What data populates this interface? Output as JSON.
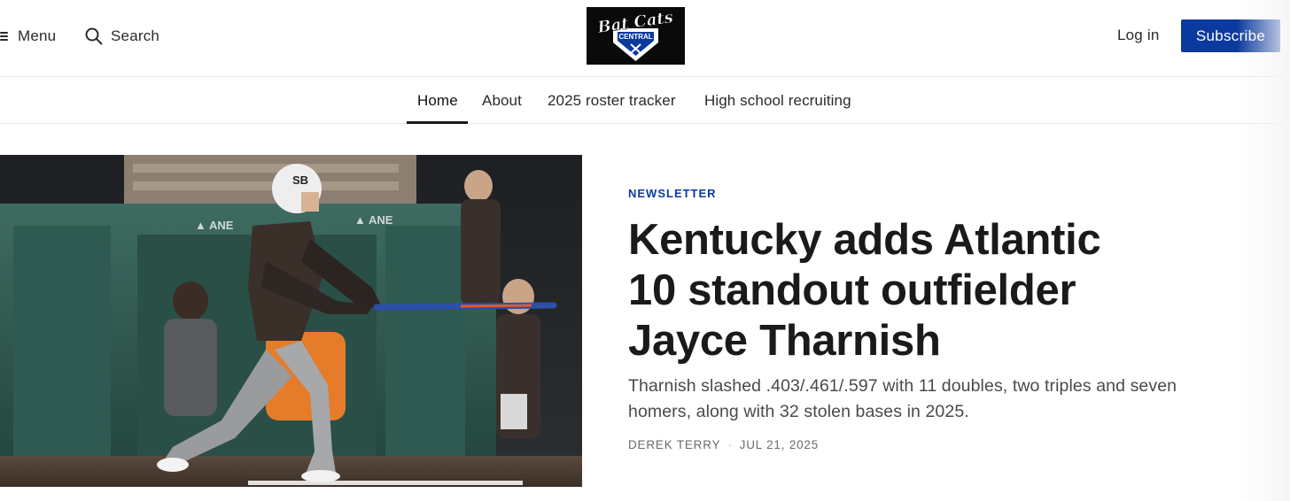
{
  "header": {
    "menu_label": "Menu",
    "search_label": "Search",
    "logo_text_top": "Bat Cats",
    "logo_text_bottom": "CENTRAL",
    "login_label": "Log in",
    "subscribe_label": "Subscribe",
    "accent_color": "#0b3a9e"
  },
  "nav": {
    "items": [
      {
        "label": "Home",
        "active": true
      },
      {
        "label": "About",
        "active": false
      },
      {
        "label": "2025 roster tracker",
        "active": false
      },
      {
        "label": "High school recruiting",
        "active": false
      }
    ]
  },
  "article": {
    "category": "NEWSLETTER",
    "headline": "Kentucky adds Atlantic 10 standout outfielder Jayce Tharnish",
    "subtitle": "Tharnish slashed .403/.461/.597 with 11 doubles, two triples and seven homers, along with 32 stolen bases in 2025.",
    "author": "DEREK TERRY",
    "date": "JUL 21, 2025",
    "separator": "·",
    "image_helmet_logo": "SB"
  },
  "icons": {
    "menu": "hamburger-icon",
    "search": "search-icon"
  }
}
